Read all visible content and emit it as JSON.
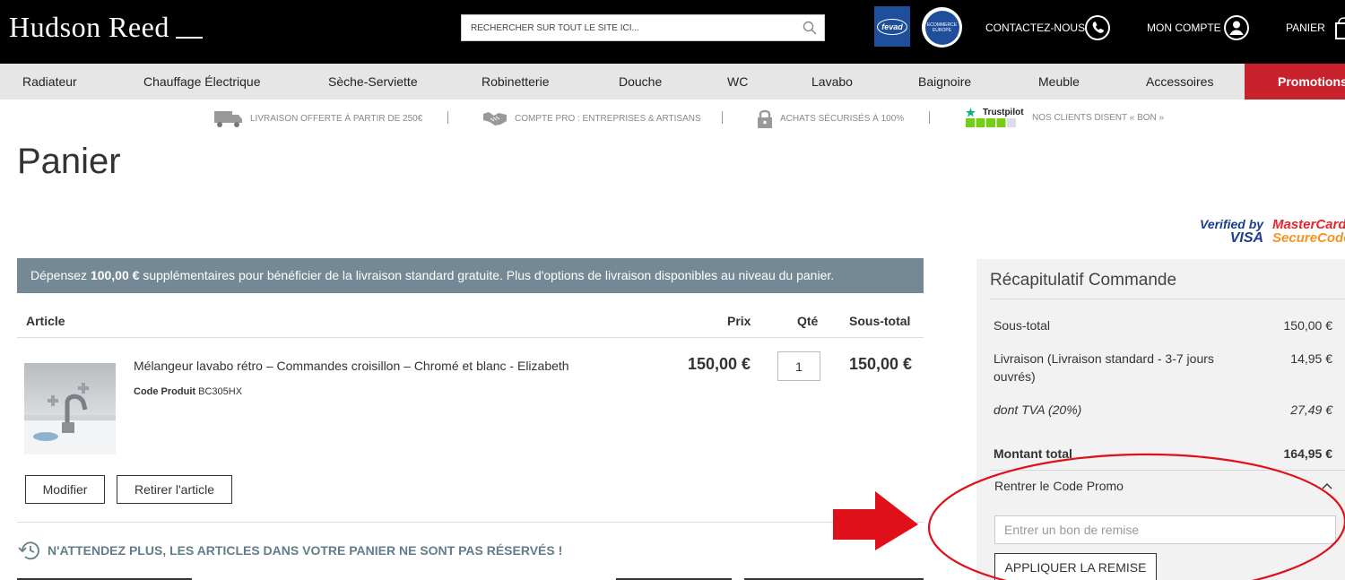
{
  "header": {
    "logo": "Hudson Reed",
    "search_placeholder": "RECHERCHER SUR TOUT LE SITE ICI...",
    "fevad_label": "fevad",
    "ecommerce_label": "ECOMMERCE EUROPE",
    "contact": "CONTACTEZ-NOUS",
    "account": "MON COMPTE",
    "cart": "PANIER"
  },
  "nav": {
    "items": [
      "Radiateur",
      "Chauffage Électrique",
      "Sèche-Serviette",
      "Robinetterie",
      "Douche",
      "WC",
      "Lavabo",
      "Baignoire",
      "Meuble",
      "Accessoires"
    ],
    "promo": "Promotions"
  },
  "usp": {
    "delivery": "LIVRAISON OFFERTE À PARTIR DE 250€",
    "pro": "COMPTE PRO : ENTREPRISES & ARTISANS",
    "secure": "ACHATS SÉCURISÉS À 100%",
    "trustpilot_brand": "Trustpilot",
    "reviews": "NOS CLIENTS DISENT « BON »"
  },
  "page": {
    "title": "Panier"
  },
  "payment_badges": {
    "visa_line1": "Verified by",
    "visa_line2": "VISA",
    "mc_line1": "MasterCard.",
    "mc_line2": "SecureCode."
  },
  "banner": {
    "pre": "Dépensez ",
    "amount": "100,00 €",
    "post": " supplémentaires pour bénéficier de la livraison standard gratuite. Plus d'options de livraison disponibles au niveau du panier."
  },
  "table": {
    "col_article": "Article",
    "col_price": "Prix",
    "col_qty": "Qté",
    "col_subtotal": "Sous-total"
  },
  "item": {
    "name": "Mélangeur lavabo rétro – Commandes croisillon – Chromé et blanc - Elizabeth",
    "code_label": "Code Produit",
    "code": "BC305HX",
    "price": "150,00 €",
    "qty": "1",
    "subtotal": "150,00 €",
    "edit": "Modifier",
    "remove": "Retirer l'article"
  },
  "notice": "N'ATTENDEZ PLUS, LES ARTICLES DANS VOTRE PANIER NE SONT PAS RÉSERVÉS !",
  "summary": {
    "title": "Récapitulatif Commande",
    "subtotal_label": "Sous-total",
    "subtotal": "150,00 €",
    "shipping_label": "Livraison (Livraison standard - 3-7 jours ouvrés)",
    "shipping": "14,95 €",
    "vat_label": "dont TVA (20%)",
    "vat": "27,49 €",
    "total_label": "Montant total",
    "total": "164,95 €",
    "promo_label": "Rentrer le Code Promo",
    "promo_placeholder": "Entrer un bon de remise",
    "apply": "APPLIQUER LA REMISE"
  },
  "colors": {
    "header_bg": "#000000",
    "nav_bg": "#e6e6e6",
    "promo_bg": "#c8232c",
    "banner_bg": "#758895",
    "annotation_red": "#e0101a"
  }
}
